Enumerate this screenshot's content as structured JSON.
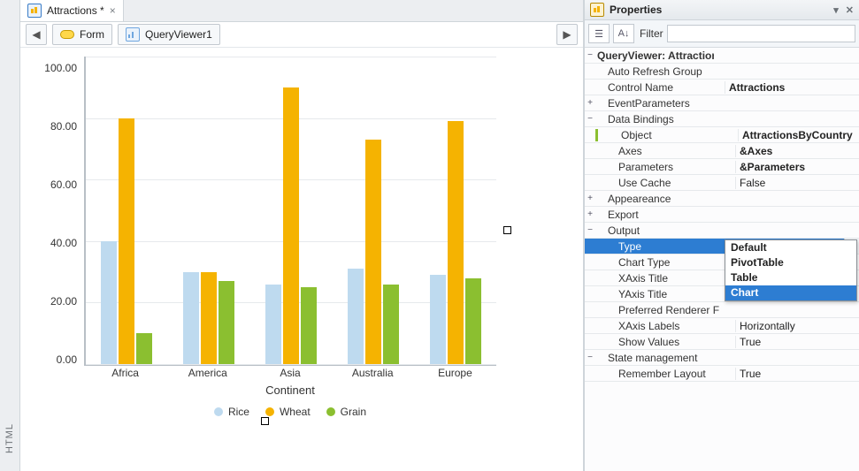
{
  "leftRail": {
    "label": "HTML"
  },
  "tab": {
    "title": "Attractions *",
    "close": "×"
  },
  "toolbar": {
    "prev": "◀",
    "next": "▶",
    "form": "Form",
    "query_viewer": "QueryViewer1"
  },
  "chart_data": {
    "type": "bar",
    "categories": [
      "Africa",
      "America",
      "Asia",
      "Australia",
      "Europe"
    ],
    "series": [
      {
        "name": "Rice",
        "color": "#bedaef",
        "values": [
          40,
          30,
          26,
          31,
          29
        ]
      },
      {
        "name": "Wheat",
        "color": "#f5b301",
        "values": [
          80,
          30,
          90,
          73,
          79
        ]
      },
      {
        "name": "Grain",
        "color": "#8bbf30",
        "values": [
          10,
          27,
          25,
          26,
          28
        ]
      }
    ],
    "xlabel": "Continent",
    "ylabel": "",
    "ylim": [
      0,
      100
    ],
    "yticks": [
      "100.00",
      "80.00",
      "60.00",
      "40.00",
      "20.00",
      "0.00"
    ]
  },
  "props": {
    "panel_title": "Properties",
    "filter_label": "Filter",
    "filter_value": "",
    "header": "QueryViewer: Attractions",
    "rows": {
      "auto_refresh": {
        "label": "Auto Refresh Group",
        "value": ""
      },
      "control_name": {
        "label": "Control Name",
        "value": "Attractions",
        "bold": true
      },
      "event_params": {
        "label": "EventParameters"
      },
      "data_bindings": {
        "label": "Data Bindings"
      },
      "object": {
        "label": "Object",
        "value": "AttractionsByCountry",
        "bold": true
      },
      "axes": {
        "label": "Axes",
        "value": "&Axes",
        "bold": true
      },
      "parameters": {
        "label": "Parameters",
        "value": "&Parameters",
        "bold": true
      },
      "use_cache": {
        "label": "Use Cache",
        "value": "False"
      },
      "appearance": {
        "label": "Appeareance"
      },
      "export": {
        "label": "Export"
      },
      "output": {
        "label": "Output"
      },
      "type": {
        "label": "Type",
        "value": "Chart"
      },
      "chart_type": {
        "label": "Chart Type",
        "value": ""
      },
      "xaxis_title": {
        "label": "XAxis Title",
        "value": ""
      },
      "yaxis_title": {
        "label": "YAxis Title",
        "value": ""
      },
      "pref_renderer": {
        "label": "Preferred Renderer F",
        "value": ""
      },
      "xaxis_labels": {
        "label": "XAxis Labels",
        "value": "Horizontally"
      },
      "show_values": {
        "label": "Show Values",
        "value": "True"
      },
      "state_mgmt": {
        "label": "State management"
      },
      "remember_layout": {
        "label": "Remember Layout",
        "value": "True"
      }
    },
    "dropdown": {
      "options": [
        "Default",
        "PivotTable",
        "Table",
        "Chart"
      ],
      "highlight": "Chart"
    }
  },
  "glyphs": {
    "pin": "📌",
    "close": "✕",
    "collapse": "−",
    "expand": "+",
    "dd": "▾",
    "cat": "📄",
    "az": "A↓"
  }
}
